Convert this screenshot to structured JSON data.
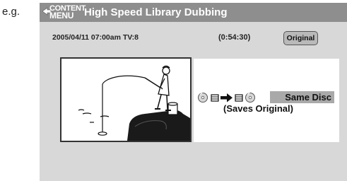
{
  "example_label": "e.g.",
  "menu": {
    "logo_line1": "CONTENT",
    "logo_line2": "MENU"
  },
  "title": "High Speed Library Dubbing",
  "recording": {
    "datetime": "2005/04/11  07:00am  TV:8",
    "duration": "(0:54:30)",
    "badge": "Original"
  },
  "dubbing": {
    "icons": [
      "disc-icon",
      "title-icon",
      "arrow-right-icon",
      "title-icon",
      "disc-icon"
    ],
    "destination": "Same Disc",
    "note": "(Saves Original)"
  },
  "thumbnail": {
    "subject": "fisherman-illustration"
  },
  "colors": {
    "title_bar": "#8e8e8e",
    "screen_bg": "#d8d8d8",
    "highlight": "#a9a9a9"
  }
}
